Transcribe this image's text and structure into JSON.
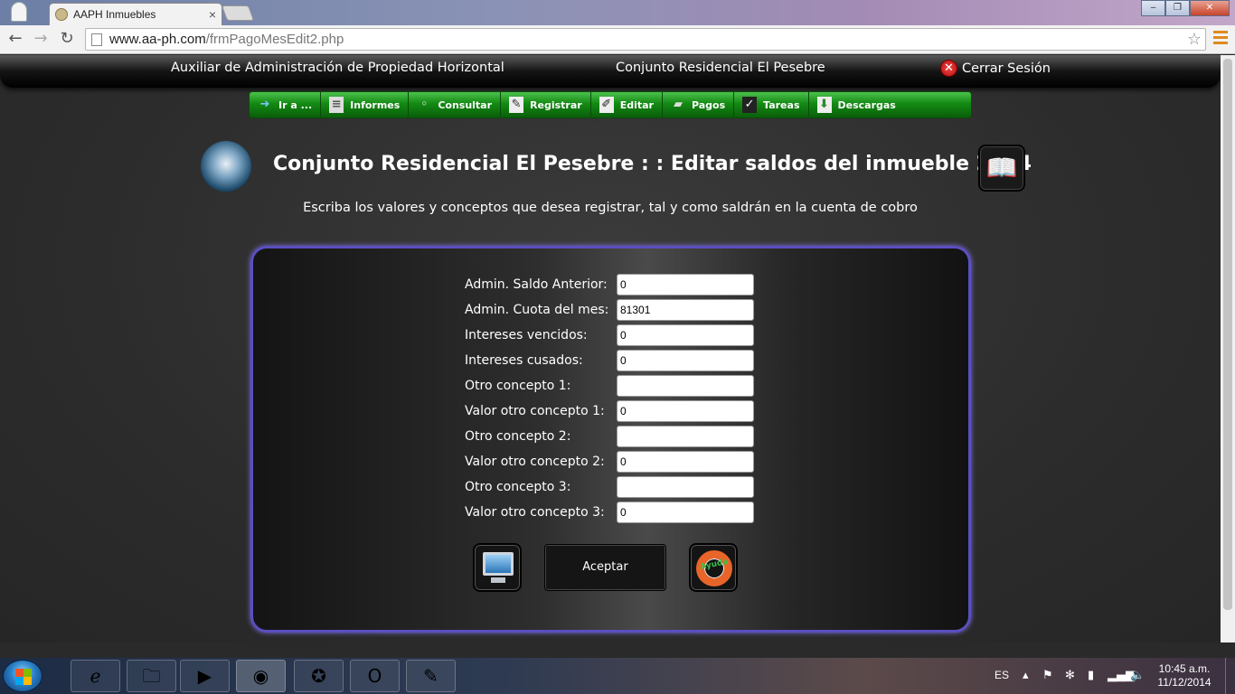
{
  "browser": {
    "tab_title": "AAPH Inmuebles",
    "tab_close": "×",
    "url_host": "www.aa-ph.com",
    "url_path": "/frmPagoMesEdit2.php",
    "window_buttons": [
      "‒",
      "❐",
      "✕"
    ]
  },
  "header": {
    "left": "Auxiliar de Administración de Propiedad Horizontal",
    "center": "Conjunto Residencial El Pesebre",
    "logout": "Cerrar Sesión"
  },
  "menu": [
    {
      "label": "Ir a ...",
      "icon": "arrow-icon"
    },
    {
      "label": "Informes",
      "icon": "report-icon"
    },
    {
      "label": "Consultar",
      "icon": "search-icon"
    },
    {
      "label": "Registrar",
      "icon": "pencil-icon"
    },
    {
      "label": "Editar",
      "icon": "edit-icon"
    },
    {
      "label": "Pagos",
      "icon": "money-icon"
    },
    {
      "label": "Tareas",
      "icon": "tasks-icon"
    },
    {
      "label": "Descargas",
      "icon": "download-icon"
    }
  ],
  "page": {
    "title": "Conjunto Residencial El Pesebre : : Editar saldos del inmueble 2304",
    "subtitle": "Escriba los valores y conceptos que desea registrar, tal y como saldrán en la cuenta de cobro"
  },
  "form": {
    "fields": [
      {
        "label": "Admin. Saldo Anterior:",
        "value": "0"
      },
      {
        "label": "Admin. Cuota del mes:",
        "value": "81301"
      },
      {
        "label": "Intereses vencidos:",
        "value": "0"
      },
      {
        "label": "Intereses cusados:",
        "value": "0"
      },
      {
        "label": "Otro concepto 1:",
        "value": ""
      },
      {
        "label": "Valor otro concepto 1:",
        "value": "0"
      },
      {
        "label": "Otro concepto 2:",
        "value": ""
      },
      {
        "label": "Valor otro concepto 2:",
        "value": "0"
      },
      {
        "label": "Otro concepto 3:",
        "value": ""
      },
      {
        "label": "Valor otro concepto 3:",
        "value": "0"
      }
    ],
    "accept_label": "Aceptar",
    "help_label": "Ayuda"
  },
  "taskbar": {
    "language": "ES",
    "time": "10:45 a.m.",
    "date": "11/12/2014"
  }
}
